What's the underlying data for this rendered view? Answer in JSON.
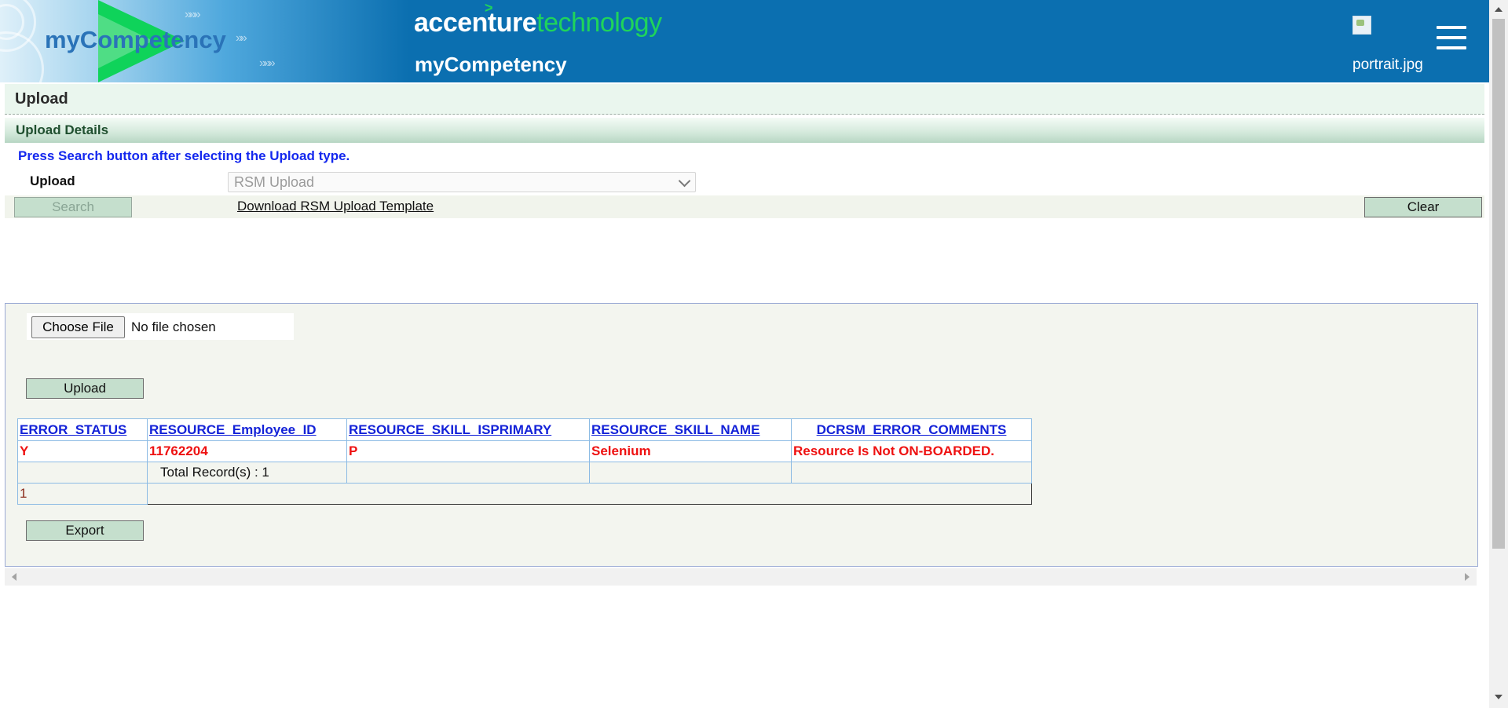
{
  "header": {
    "art_title": "myCompetency",
    "brand_primary": "accenture",
    "brand_secondary": "technology",
    "brand_caret": ">",
    "sub_brand": "myCompetency",
    "portrait_alt": "portrait.jpg",
    "menu_icon": "hamburger-menu-icon"
  },
  "page": {
    "title": "Upload",
    "section_title": "Upload Details",
    "hint": "Press Search button after selecting the Upload type.",
    "upload_label": "Upload",
    "upload_type_value": "RSM Upload",
    "search_label": "Search",
    "download_link": "Download RSM Upload Template",
    "clear_label": "Clear"
  },
  "upload_panel": {
    "choose_file_label": "Choose File",
    "file_status": "No file chosen",
    "upload_label": "Upload",
    "export_label": "Export"
  },
  "table": {
    "columns": [
      "ERROR_STATUS",
      "RESOURCE_Employee_ID",
      "RESOURCE_SKILL_ISPRIMARY",
      "RESOURCE_SKILL_NAME",
      "DCRSM_ERROR_COMMENTS"
    ],
    "rows": [
      [
        "Y",
        "11762204",
        "P",
        "Selenium",
        "Resource Is Not ON-BOARDED."
      ]
    ],
    "total_records": "Total Record(s) : 1",
    "current_page": "1"
  },
  "colors": {
    "header_blue": "#0b6fb0",
    "accent_green": "#1fd45b",
    "hint_blue": "#1428ee",
    "error_red": "#ee1111",
    "button_green": "#c5dfcd"
  }
}
